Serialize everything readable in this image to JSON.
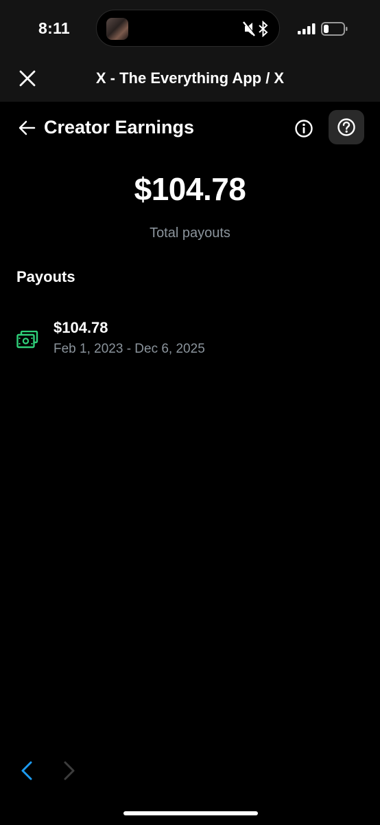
{
  "status_bar": {
    "time": "8:11",
    "island_icons": [
      "media-thumbnail",
      "mute-bell-icon",
      "bluetooth-icon"
    ],
    "indicators": [
      "cellular-signal-icon",
      "battery-icon"
    ]
  },
  "browser": {
    "title": "X - The Everything App / X",
    "close_icon": "close-icon"
  },
  "header": {
    "title": "Creator Earnings",
    "back_icon": "back-arrow-icon",
    "info_icon": "info-icon",
    "help_icon": "help-icon"
  },
  "summary": {
    "total": "$104.78",
    "label": "Total payouts"
  },
  "payouts": {
    "section_title": "Payouts",
    "items": [
      {
        "amount": "$104.78",
        "range": "Feb 1, 2023 - Dec 6, 2025",
        "icon": "cash-icon"
      }
    ]
  },
  "navigation": {
    "back_icon": "chevron-left-icon",
    "forward_icon": "chevron-right-icon"
  },
  "colors": {
    "background": "#000000",
    "bar_background": "#141414",
    "secondary_text": "#8b949c",
    "cash_green": "#2fd17a",
    "link_blue": "#1d9bf0",
    "disabled_gray": "#3c3c3c"
  }
}
